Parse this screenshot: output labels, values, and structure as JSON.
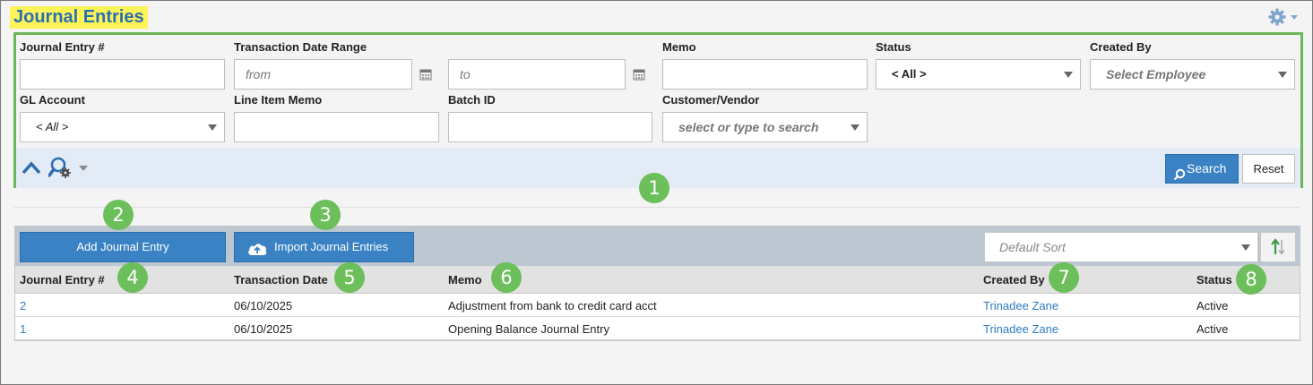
{
  "page": {
    "title": "Journal Entries"
  },
  "icons": {
    "settings": "gear-icon",
    "collapse": "chevron-up-icon",
    "search_options": "search-settings-icon",
    "calendar": "calendar-icon",
    "upload": "cloud-upload-icon",
    "sort_direction": "sort-arrows-icon"
  },
  "colors": {
    "accent": "#3a82c4",
    "title_highlight": "#fff35a",
    "annotation_green": "#6cbf5b",
    "link": "#2e7bbf"
  },
  "filters": {
    "journal_entry_label": "Journal Entry #",
    "journal_entry_value": "",
    "date_range_label": "Transaction Date Range",
    "date_from_placeholder": "from",
    "date_to_placeholder": "to",
    "memo_label": "Memo",
    "memo_value": "",
    "status_label": "Status",
    "status_value": "< All >",
    "created_by_label": "Created By",
    "created_by_placeholder": "Select Employee",
    "gl_account_label": "GL Account",
    "gl_account_value": "< All >",
    "line_item_memo_label": "Line Item Memo",
    "batch_id_label": "Batch ID",
    "customer_vendor_label": "Customer/Vendor",
    "customer_vendor_placeholder": "select or type to search",
    "search_button": "Search",
    "reset_button": "Reset"
  },
  "annotations": [
    "1",
    "2",
    "3",
    "4",
    "5",
    "6",
    "7",
    "8"
  ],
  "toolbar": {
    "add_button": "Add Journal Entry",
    "import_button": "Import Journal Entries",
    "sort_placeholder": "Default Sort"
  },
  "table": {
    "columns": [
      "Journal Entry #",
      "Transaction Date",
      "Memo",
      "Created By",
      "Status"
    ],
    "rows": [
      {
        "id": "2",
        "date": "06/10/2025",
        "memo": "Adjustment from bank to credit card acct",
        "created_by": "Trinadee Zane",
        "status": "Active"
      },
      {
        "id": "1",
        "date": "06/10/2025",
        "memo": "Opening Balance Journal Entry",
        "created_by": "Trinadee Zane",
        "status": "Active"
      }
    ]
  }
}
